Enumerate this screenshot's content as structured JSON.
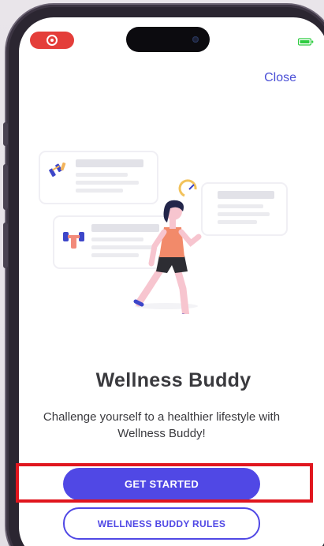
{
  "status_bar": {
    "recording_indicator": "record-icon",
    "battery_indicator": "battery-icon",
    "accent_record": "#e43e3a",
    "accent_battery": "#2ecc40"
  },
  "header": {
    "close_label": "Close"
  },
  "hero": {
    "illustration": "runner-with-activity-cards",
    "title": "Wellness Buddy",
    "subtitle": "Challenge yourself to a healthier lifestyle with Wellness Buddy!"
  },
  "actions": {
    "primary_label": "GET STARTED",
    "secondary_label": "WELLNESS BUDDY RULES"
  },
  "colors": {
    "brand": "#5048e5",
    "highlight": "#e0161e",
    "text": "#3a3a3e"
  }
}
